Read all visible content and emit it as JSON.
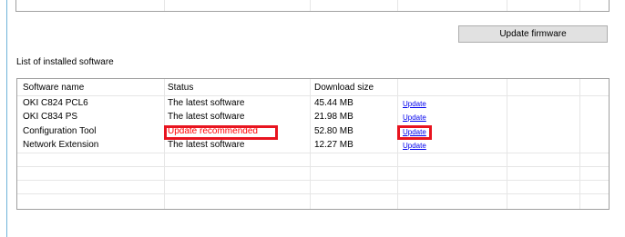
{
  "firmware": {
    "button_label": "Update firmware"
  },
  "software_list": {
    "title": "List of installed software",
    "columns": [
      "Software name",
      "Status",
      "Download size",
      ""
    ],
    "rows": [
      {
        "name": "OKI C824 PCL6",
        "status": "The latest software",
        "size": "45.44 MB",
        "action": "Update",
        "status_alert": false
      },
      {
        "name": "OKI C834 PS",
        "status": "The latest software",
        "size": "21.98 MB",
        "action": "Update",
        "status_alert": false
      },
      {
        "name": "Configuration Tool",
        "status": "Update recommended",
        "size": "52.80 MB",
        "action": "Update",
        "status_alert": true,
        "highlighted": true
      },
      {
        "name": "Network Extension",
        "status": "The latest software",
        "size": "12.27 MB",
        "action": "Update",
        "status_alert": false
      }
    ]
  },
  "colors": {
    "alert_text": "#ff0000",
    "highlight_box": "#e8141f",
    "link": "#0000ee",
    "button_face": "#e1e1e1",
    "left_rule": "#6fb3d9"
  }
}
